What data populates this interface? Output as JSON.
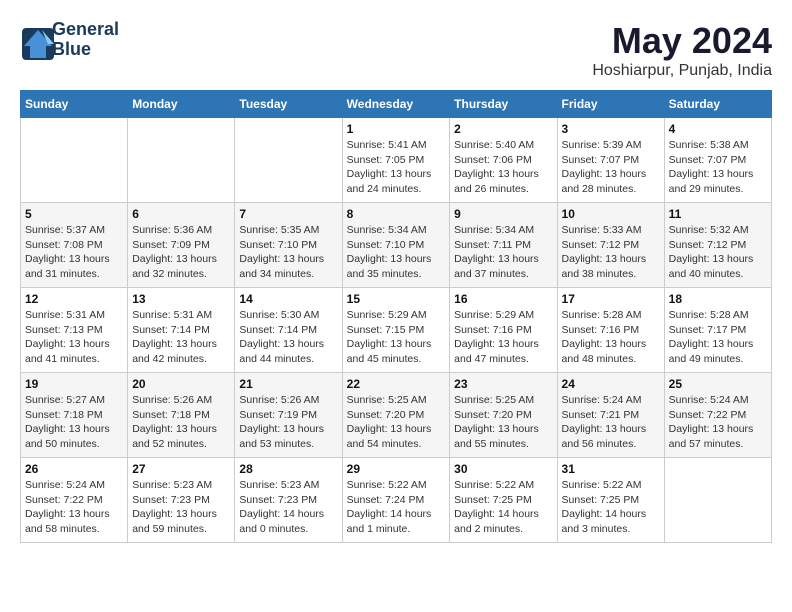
{
  "logo": {
    "line1": "General",
    "line2": "Blue"
  },
  "title": "May 2024",
  "subtitle": "Hoshiarpur, Punjab, India",
  "weekdays": [
    "Sunday",
    "Monday",
    "Tuesday",
    "Wednesday",
    "Thursday",
    "Friday",
    "Saturday"
  ],
  "weeks": [
    [
      {
        "day": "",
        "info": ""
      },
      {
        "day": "",
        "info": ""
      },
      {
        "day": "",
        "info": ""
      },
      {
        "day": "1",
        "info": "Sunrise: 5:41 AM\nSunset: 7:05 PM\nDaylight: 13 hours\nand 24 minutes."
      },
      {
        "day": "2",
        "info": "Sunrise: 5:40 AM\nSunset: 7:06 PM\nDaylight: 13 hours\nand 26 minutes."
      },
      {
        "day": "3",
        "info": "Sunrise: 5:39 AM\nSunset: 7:07 PM\nDaylight: 13 hours\nand 28 minutes."
      },
      {
        "day": "4",
        "info": "Sunrise: 5:38 AM\nSunset: 7:07 PM\nDaylight: 13 hours\nand 29 minutes."
      }
    ],
    [
      {
        "day": "5",
        "info": "Sunrise: 5:37 AM\nSunset: 7:08 PM\nDaylight: 13 hours\nand 31 minutes."
      },
      {
        "day": "6",
        "info": "Sunrise: 5:36 AM\nSunset: 7:09 PM\nDaylight: 13 hours\nand 32 minutes."
      },
      {
        "day": "7",
        "info": "Sunrise: 5:35 AM\nSunset: 7:10 PM\nDaylight: 13 hours\nand 34 minutes."
      },
      {
        "day": "8",
        "info": "Sunrise: 5:34 AM\nSunset: 7:10 PM\nDaylight: 13 hours\nand 35 minutes."
      },
      {
        "day": "9",
        "info": "Sunrise: 5:34 AM\nSunset: 7:11 PM\nDaylight: 13 hours\nand 37 minutes."
      },
      {
        "day": "10",
        "info": "Sunrise: 5:33 AM\nSunset: 7:12 PM\nDaylight: 13 hours\nand 38 minutes."
      },
      {
        "day": "11",
        "info": "Sunrise: 5:32 AM\nSunset: 7:12 PM\nDaylight: 13 hours\nand 40 minutes."
      }
    ],
    [
      {
        "day": "12",
        "info": "Sunrise: 5:31 AM\nSunset: 7:13 PM\nDaylight: 13 hours\nand 41 minutes."
      },
      {
        "day": "13",
        "info": "Sunrise: 5:31 AM\nSunset: 7:14 PM\nDaylight: 13 hours\nand 42 minutes."
      },
      {
        "day": "14",
        "info": "Sunrise: 5:30 AM\nSunset: 7:14 PM\nDaylight: 13 hours\nand 44 minutes."
      },
      {
        "day": "15",
        "info": "Sunrise: 5:29 AM\nSunset: 7:15 PM\nDaylight: 13 hours\nand 45 minutes."
      },
      {
        "day": "16",
        "info": "Sunrise: 5:29 AM\nSunset: 7:16 PM\nDaylight: 13 hours\nand 47 minutes."
      },
      {
        "day": "17",
        "info": "Sunrise: 5:28 AM\nSunset: 7:16 PM\nDaylight: 13 hours\nand 48 minutes."
      },
      {
        "day": "18",
        "info": "Sunrise: 5:28 AM\nSunset: 7:17 PM\nDaylight: 13 hours\nand 49 minutes."
      }
    ],
    [
      {
        "day": "19",
        "info": "Sunrise: 5:27 AM\nSunset: 7:18 PM\nDaylight: 13 hours\nand 50 minutes."
      },
      {
        "day": "20",
        "info": "Sunrise: 5:26 AM\nSunset: 7:18 PM\nDaylight: 13 hours\nand 52 minutes."
      },
      {
        "day": "21",
        "info": "Sunrise: 5:26 AM\nSunset: 7:19 PM\nDaylight: 13 hours\nand 53 minutes."
      },
      {
        "day": "22",
        "info": "Sunrise: 5:25 AM\nSunset: 7:20 PM\nDaylight: 13 hours\nand 54 minutes."
      },
      {
        "day": "23",
        "info": "Sunrise: 5:25 AM\nSunset: 7:20 PM\nDaylight: 13 hours\nand 55 minutes."
      },
      {
        "day": "24",
        "info": "Sunrise: 5:24 AM\nSunset: 7:21 PM\nDaylight: 13 hours\nand 56 minutes."
      },
      {
        "day": "25",
        "info": "Sunrise: 5:24 AM\nSunset: 7:22 PM\nDaylight: 13 hours\nand 57 minutes."
      }
    ],
    [
      {
        "day": "26",
        "info": "Sunrise: 5:24 AM\nSunset: 7:22 PM\nDaylight: 13 hours\nand 58 minutes."
      },
      {
        "day": "27",
        "info": "Sunrise: 5:23 AM\nSunset: 7:23 PM\nDaylight: 13 hours\nand 59 minutes."
      },
      {
        "day": "28",
        "info": "Sunrise: 5:23 AM\nSunset: 7:23 PM\nDaylight: 14 hours\nand 0 minutes."
      },
      {
        "day": "29",
        "info": "Sunrise: 5:22 AM\nSunset: 7:24 PM\nDaylight: 14 hours\nand 1 minute."
      },
      {
        "day": "30",
        "info": "Sunrise: 5:22 AM\nSunset: 7:25 PM\nDaylight: 14 hours\nand 2 minutes."
      },
      {
        "day": "31",
        "info": "Sunrise: 5:22 AM\nSunset: 7:25 PM\nDaylight: 14 hours\nand 3 minutes."
      },
      {
        "day": "",
        "info": ""
      }
    ]
  ]
}
